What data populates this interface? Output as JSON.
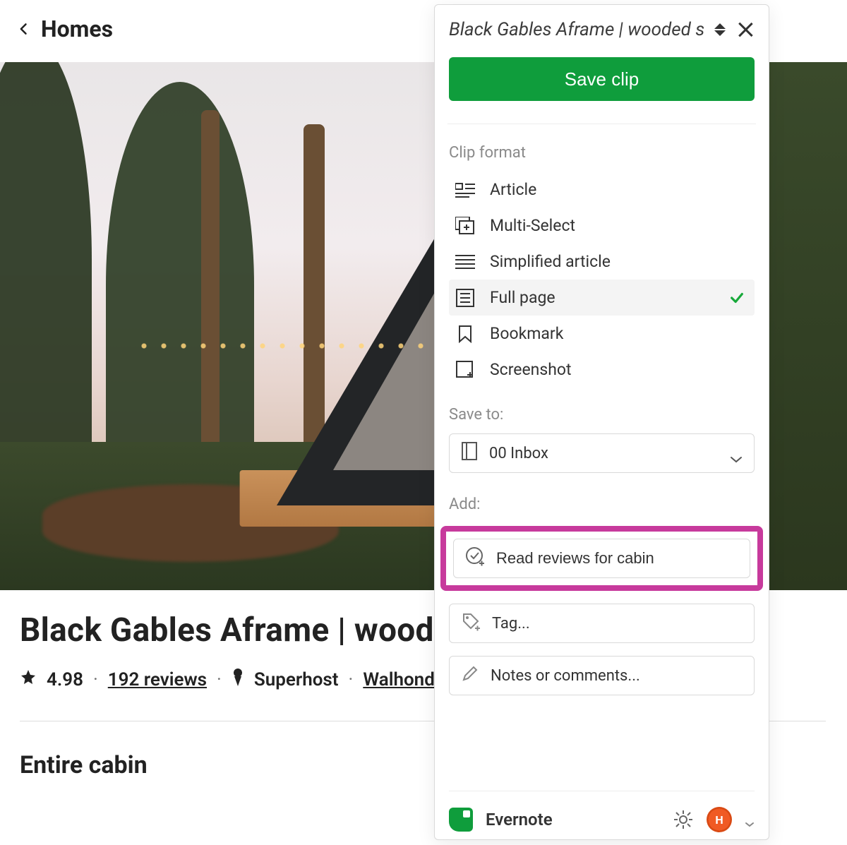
{
  "page": {
    "back_label": "Homes",
    "listing_title": "Black Gables Aframe | wooded",
    "rating": "4.98",
    "reviews_text": "192 reviews",
    "superhost": "Superhost",
    "location": "Walhonding, Ohio",
    "subheading": "Entire cabin"
  },
  "clipper": {
    "title": "Black Gables Aframe | wooded s",
    "save_button": "Save clip",
    "clip_format_label": "Clip format",
    "formats": [
      {
        "id": "article",
        "label": "Article",
        "selected": false
      },
      {
        "id": "multi-select",
        "label": "Multi-Select",
        "selected": false
      },
      {
        "id": "simplified",
        "label": "Simplified article",
        "selected": false
      },
      {
        "id": "full-page",
        "label": "Full page",
        "selected": true
      },
      {
        "id": "bookmark",
        "label": "Bookmark",
        "selected": false
      },
      {
        "id": "screenshot",
        "label": "Screenshot",
        "selected": false
      }
    ],
    "save_to_label": "Save to:",
    "save_to_value": "00 Inbox",
    "add_label": "Add:",
    "task_value": "Read reviews for cabin",
    "tag_placeholder": "Tag...",
    "notes_placeholder": "Notes or comments...",
    "brand": "Evernote",
    "avatar_initial": "H"
  }
}
